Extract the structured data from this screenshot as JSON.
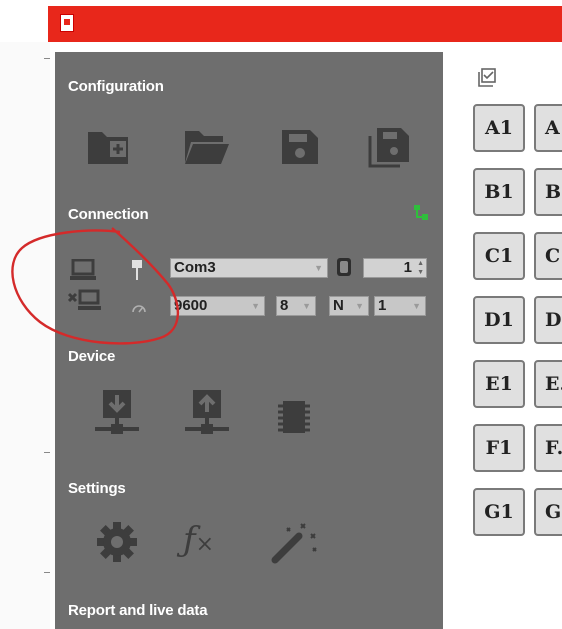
{
  "app": {
    "logo_icon": "app-logo-icon",
    "titlebar_color": "#e8271b",
    "panel_color": "#6e6e6e"
  },
  "sections": {
    "configuration": "Configuration",
    "connection": "Connection",
    "device": "Device",
    "settings": "Settings",
    "report": "Report and live data"
  },
  "configuration_icons": [
    "new-folder-icon",
    "open-folder-icon",
    "save-icon",
    "save-as-icon"
  ],
  "connection": {
    "status_icon": "network-status-icon",
    "connect_icon": "connect-computer-icon",
    "disconnect_icon": "disconnect-computer-icon",
    "port_icon": "usb-plug-icon",
    "speed_icon": "gauge-icon",
    "port_value": "Com3",
    "address_icon": "address-icon",
    "address_value": "1",
    "baud_value": "9600",
    "data_bits_value": "8",
    "parity_value": "N",
    "stop_bits_value": "1"
  },
  "device_icons": [
    "download-to-device-icon",
    "upload-from-device-icon",
    "chip-icon"
  ],
  "settings_icons": [
    "gear-icon",
    "function-icon",
    "magic-wand-icon"
  ],
  "grid": {
    "select_icon": "select-all-icon",
    "rows": [
      {
        "c1": "A1",
        "c2": "A"
      },
      {
        "c1": "B1",
        "c2": "B"
      },
      {
        "c1": "C1",
        "c2": "C"
      },
      {
        "c1": "D1",
        "c2": "D"
      },
      {
        "c1": "E1",
        "c2": "E."
      },
      {
        "c1": "F1",
        "c2": "F."
      },
      {
        "c1": "G1",
        "c2": "G"
      }
    ]
  }
}
